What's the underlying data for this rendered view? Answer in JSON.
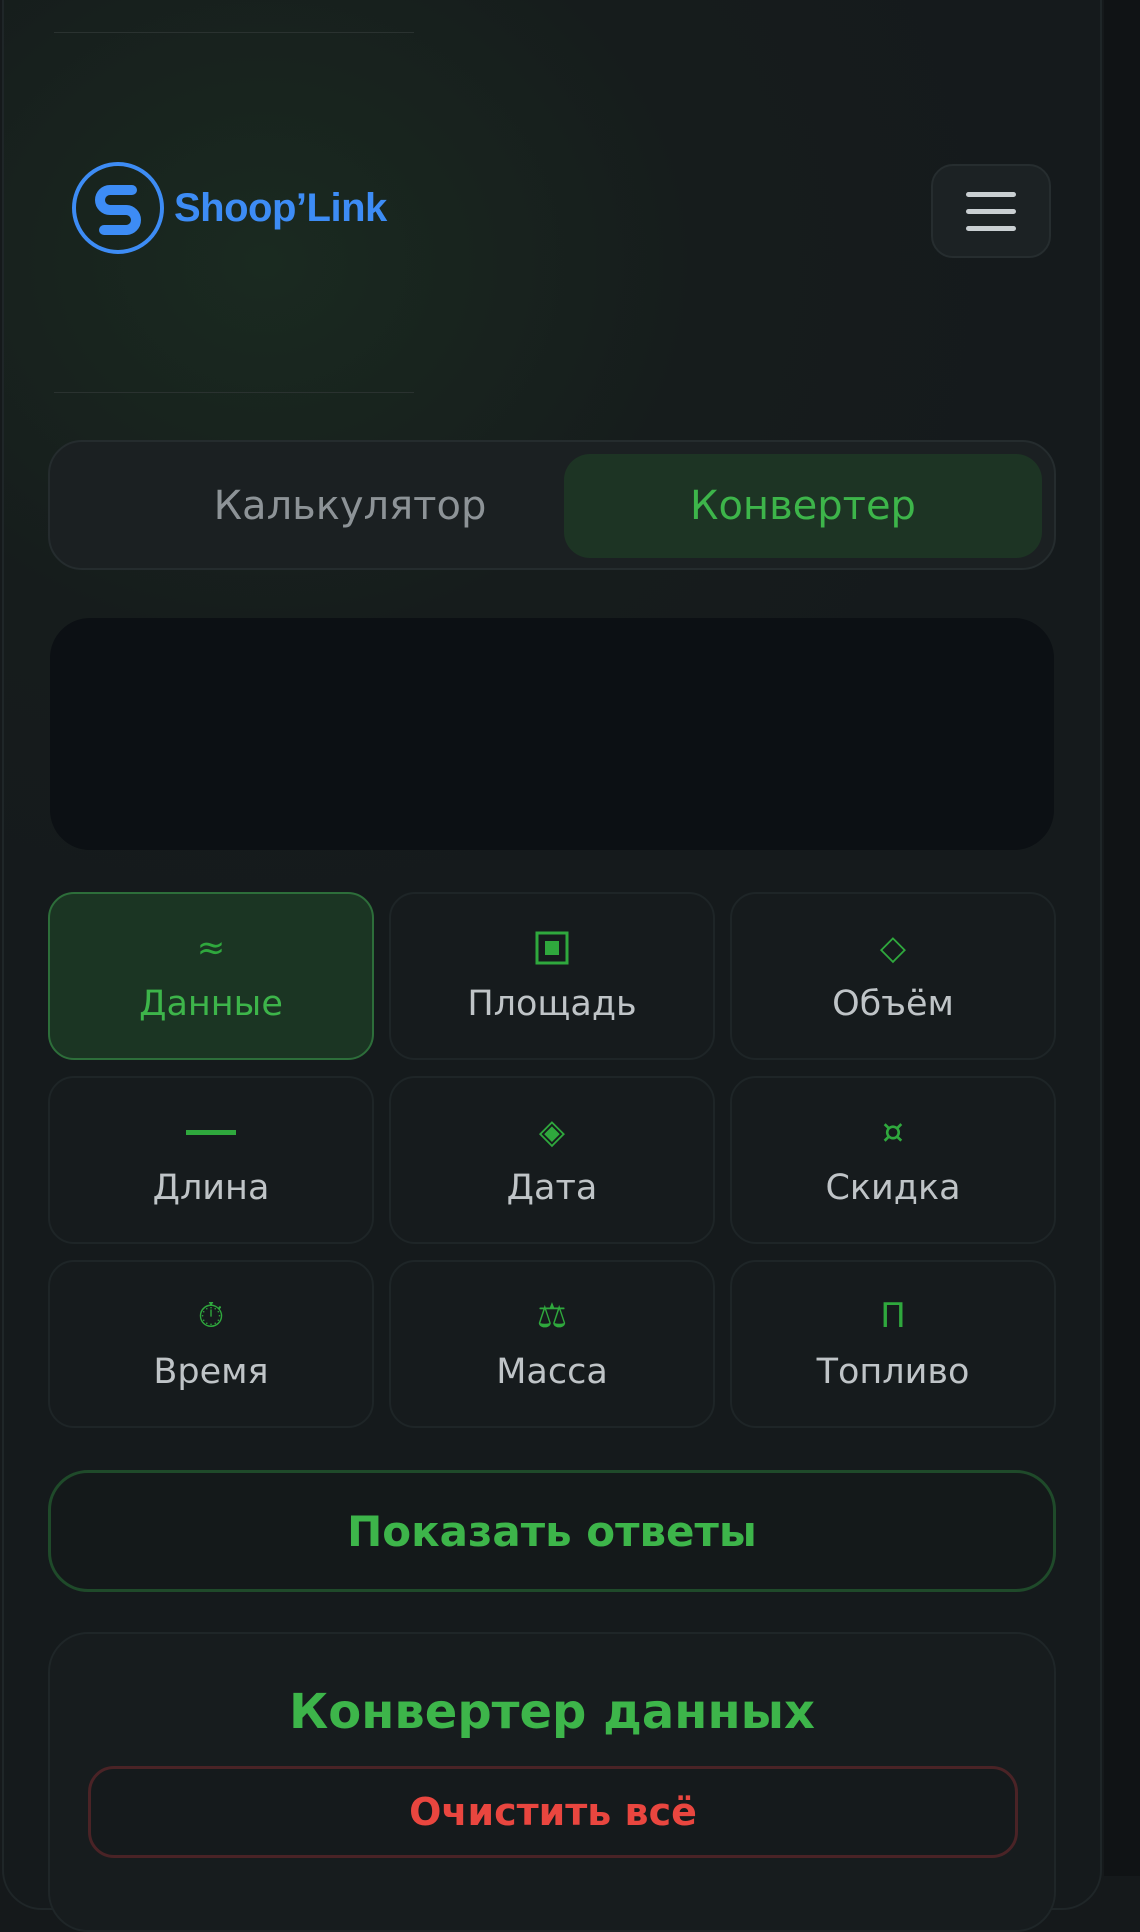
{
  "header": {
    "brand": "Shoop’Link",
    "logo_icon": "shooplink-s-logo",
    "menu_icon": "hamburger-menu-icon"
  },
  "tabs": {
    "calculator": "Калькулятор",
    "converter": "Конвертер",
    "active": "converter"
  },
  "display": {
    "value": ""
  },
  "categories": [
    {
      "label": "Данные",
      "icon": "approx-icon",
      "glyph": "≈",
      "active": true
    },
    {
      "label": "Площадь",
      "icon": "square-icon",
      "glyph": "",
      "active": false
    },
    {
      "label": "Объём",
      "icon": "diamond-outline-icon",
      "glyph": "◇",
      "active": false
    },
    {
      "label": "Длина",
      "icon": "line-icon",
      "glyph": "",
      "active": false
    },
    {
      "label": "Дата",
      "icon": "diamond-filled-icon",
      "glyph": "◈",
      "active": false
    },
    {
      "label": "Скидка",
      "icon": "currency-icon",
      "glyph": "¤",
      "active": false
    },
    {
      "label": "Время",
      "icon": "stopwatch-icon",
      "glyph": "⏱",
      "active": false
    },
    {
      "label": "Масса",
      "icon": "scales-icon",
      "glyph": "⚖",
      "active": false
    },
    {
      "label": "Топливо",
      "icon": "pi-icon",
      "glyph": "Π",
      "active": false
    }
  ],
  "actions": {
    "show_answers": "Показать ответы"
  },
  "converter_card": {
    "title": "Конвертер данных",
    "clear_all": "Очистить всё"
  },
  "colors": {
    "accent_green": "#3db54a",
    "brand_blue": "#3d8cf5",
    "danger_red": "#e9463f",
    "background": "#15191b"
  }
}
